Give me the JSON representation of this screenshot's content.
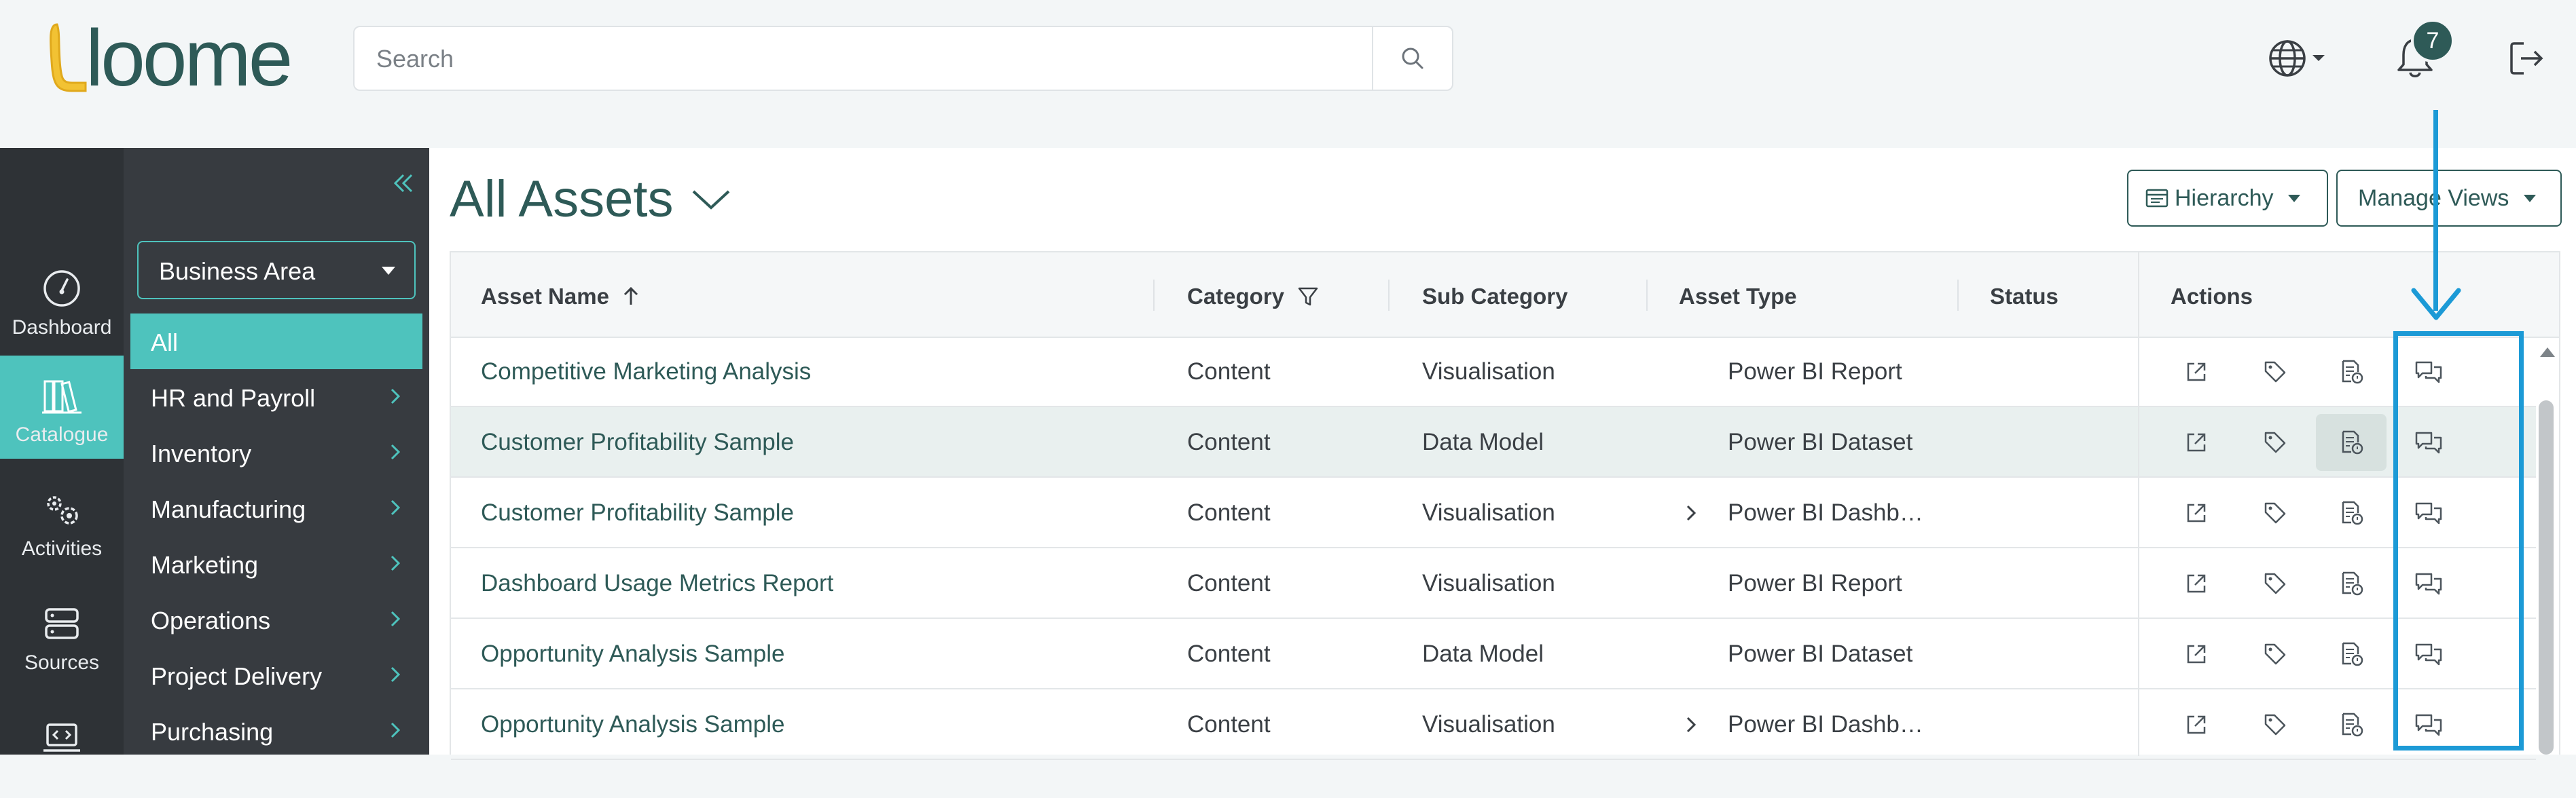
{
  "header": {
    "logo_text": "loome",
    "search_placeholder": "Search",
    "notification_count": "7"
  },
  "sidebar": {
    "items": [
      {
        "label": "Dashboard",
        "icon": "dashboard-gauge-icon",
        "active": false
      },
      {
        "label": "Catalogue",
        "icon": "books-icon",
        "active": true
      },
      {
        "label": "Activities",
        "icon": "gears-icon",
        "active": false
      },
      {
        "label": "Sources",
        "icon": "server-icon",
        "active": false
      },
      {
        "label": "",
        "icon": "code-laptop-icon",
        "active": false
      }
    ]
  },
  "subnav": {
    "dropdown_label": "Business Area",
    "items": [
      {
        "label": "All",
        "active": true
      },
      {
        "label": "HR and Payroll"
      },
      {
        "label": "Inventory"
      },
      {
        "label": "Manufacturing"
      },
      {
        "label": "Marketing"
      },
      {
        "label": "Operations"
      },
      {
        "label": "Project Delivery"
      },
      {
        "label": "Purchasing"
      }
    ]
  },
  "main": {
    "title": "All Assets",
    "hierarchy_button": "Hierarchy",
    "manage_views_button": "Manage Views"
  },
  "table": {
    "columns": [
      "Asset Name",
      "Category",
      "Sub Category",
      "Asset Type",
      "Status",
      "Actions"
    ],
    "rows": [
      {
        "name": "Competitive Marketing Analysis",
        "category": "Content",
        "sub_category": "Visualisation",
        "asset_type": "Power BI Report",
        "status": "",
        "expandable": false,
        "highlighted": false
      },
      {
        "name": "Customer Profitability Sample",
        "category": "Content",
        "sub_category": "Data Model",
        "asset_type": "Power BI Dataset",
        "status": "",
        "expandable": false,
        "highlighted": true
      },
      {
        "name": "Customer Profitability Sample",
        "category": "Content",
        "sub_category": "Visualisation",
        "asset_type": "Power BI Dashbo…",
        "status": "",
        "expandable": true,
        "highlighted": false
      },
      {
        "name": "Dashboard Usage Metrics Report",
        "category": "Content",
        "sub_category": "Visualisation",
        "asset_type": "Power BI Report",
        "status": "",
        "expandable": false,
        "highlighted": false
      },
      {
        "name": "Opportunity Analysis Sample",
        "category": "Content",
        "sub_category": "Data Model",
        "asset_type": "Power BI Dataset",
        "status": "",
        "expandable": false,
        "highlighted": false
      },
      {
        "name": "Opportunity Analysis Sample",
        "category": "Content",
        "sub_category": "Visualisation",
        "asset_type": "Power BI Dashbo…",
        "status": "",
        "expandable": true,
        "highlighted": false
      }
    ]
  },
  "colors": {
    "brand": "#2e5a57",
    "accent": "#4ec3bd",
    "annotation": "#1c9ad6"
  }
}
